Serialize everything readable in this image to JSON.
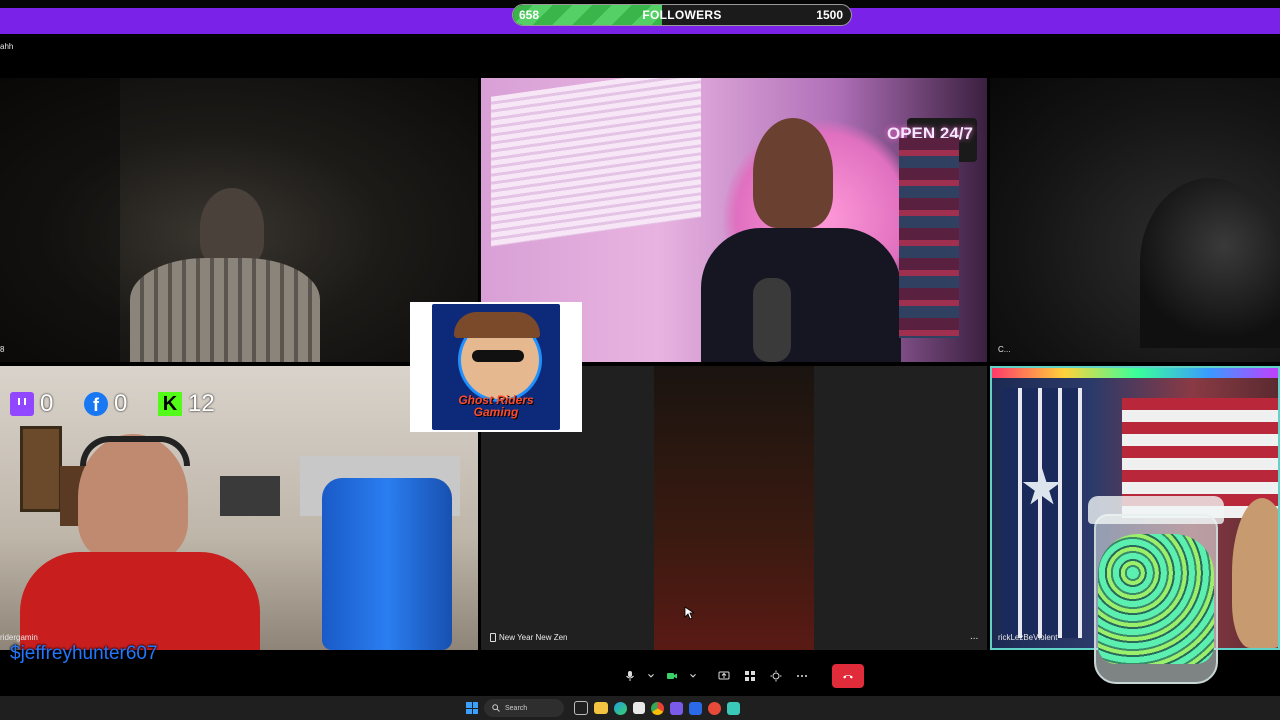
{
  "follower_goal": {
    "current": 658,
    "label": "FOLLOWERS",
    "goal": 1500,
    "progress_fraction": 0.44,
    "fill_color": "#39b54a",
    "bar_color": "#7b22e8"
  },
  "tiles": [
    {
      "id": "top-left",
      "name": "ahh",
      "corner_label": "8"
    },
    {
      "id": "top-center",
      "name": "",
      "sign_text": "OPEN 24/7"
    },
    {
      "id": "top-right",
      "name": "C..."
    },
    {
      "id": "bottom-left",
      "name": "ridergamin"
    },
    {
      "id": "bottom-center",
      "name": "New Year New Zen"
    },
    {
      "id": "bottom-right",
      "name": "rickLezBeViolent",
      "accent_color": "#5fd3c9"
    }
  ],
  "stream_stats": {
    "twitch": {
      "icon": "twitch-icon",
      "value": "0",
      "color": "#9146ff"
    },
    "facebook": {
      "icon": "facebook-icon",
      "value": "0",
      "color": "#1877f2"
    },
    "kick": {
      "icon": "kick-icon",
      "value": "12",
      "color": "#53fc18"
    }
  },
  "tiktok_handle": "$jeffreyhunter607",
  "logo": {
    "text": "Ghost Riders Gaming"
  },
  "controls": {
    "items": [
      {
        "name": "microphone-icon"
      },
      {
        "name": "chevron-down-icon"
      },
      {
        "name": "camera-icon"
      },
      {
        "name": "chevron-down-icon"
      },
      {
        "name": "share-screen-icon"
      },
      {
        "name": "layout-grid-icon"
      },
      {
        "name": "effects-icon"
      },
      {
        "name": "more-icon"
      }
    ],
    "leave_color": "#e02b3a",
    "more_label": "..."
  },
  "taskbar": {
    "search_label": "Search",
    "apps": [
      "windows-start-icon",
      "task-view-icon",
      "explorer-icon",
      "edge-icon",
      "store-icon",
      "chrome-icon",
      "app-icon",
      "app-icon",
      "app-icon",
      "app-icon"
    ]
  }
}
